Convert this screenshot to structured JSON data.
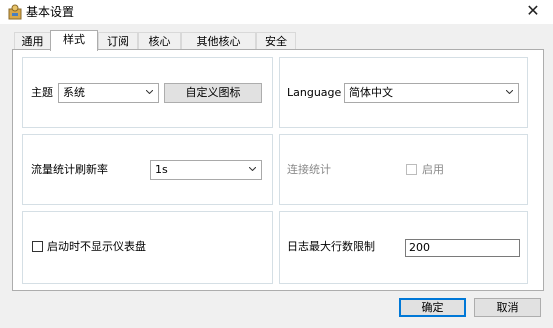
{
  "window": {
    "title": "基本设置",
    "close_glyph": "✕"
  },
  "tabs": [
    {
      "label": "通用",
      "active": false
    },
    {
      "label": "样式",
      "active": true
    },
    {
      "label": "订阅",
      "active": false
    },
    {
      "label": "核心",
      "active": false
    },
    {
      "label": "其他核心",
      "active": false
    },
    {
      "label": "安全",
      "active": false
    }
  ],
  "theme": {
    "label": "主题",
    "value": "系统",
    "custom_icon_button": "自定义图标"
  },
  "language": {
    "label": "Language",
    "value": "简体中文"
  },
  "traffic": {
    "label": "流量统计刷新率",
    "value": "1s"
  },
  "connection_stats": {
    "label": "连接统计",
    "checkbox_label": "启用",
    "checked": false,
    "disabled": true
  },
  "startup": {
    "checkbox_label": "启动时不显示仪表盘",
    "checked": false
  },
  "log_limit": {
    "label": "日志最大行数限制",
    "value": "200"
  },
  "footer": {
    "ok": "确定",
    "cancel": "取消"
  },
  "colors": {
    "accent": "#0078d7",
    "panel_border": "#adadad",
    "group_border": "#d5dfe5"
  }
}
